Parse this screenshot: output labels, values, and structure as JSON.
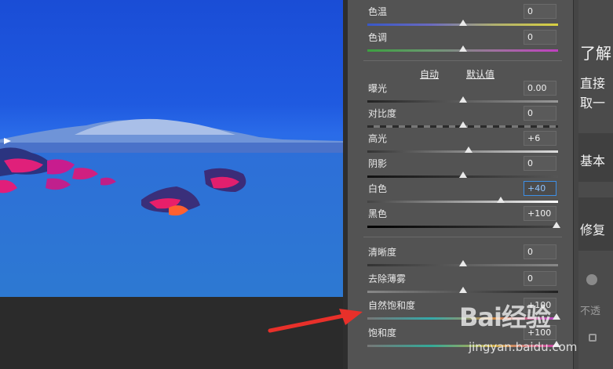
{
  "adjustments": {
    "temperature": {
      "label": "色温",
      "value": "0",
      "position": 0.5
    },
    "tint": {
      "label": "色调",
      "value": "0",
      "position": 0.5
    },
    "auto_label": "自动",
    "default_label": "默认值",
    "exposure": {
      "label": "曝光",
      "value": "0.00",
      "position": 0.5
    },
    "contrast": {
      "label": "对比度",
      "value": "0",
      "position": 0.5
    },
    "highlights": {
      "label": "高光",
      "value": "+6",
      "position": 0.53
    },
    "shadows": {
      "label": "阴影",
      "value": "0",
      "position": 0.5
    },
    "whites": {
      "label": "白色",
      "value": "+40",
      "position": 0.7
    },
    "blacks": {
      "label": "黑色",
      "value": "+100",
      "position": 1.0
    },
    "clarity": {
      "label": "清晰度",
      "value": "0",
      "position": 0.5
    },
    "dehaze": {
      "label": "去除薄雾",
      "value": "0",
      "position": 0.5
    },
    "vibrance": {
      "label": "自然饱和度",
      "value": "+100",
      "position": 1.0
    },
    "saturation": {
      "label": "饱和度",
      "value": "+100",
      "position": 1.0
    }
  },
  "article": {
    "heading_fragment": "了解",
    "line1_fragment": "直接",
    "line2_fragment": "取一",
    "section_basic": "基本",
    "section_repair": "修复",
    "opacity_fragment": "不透"
  },
  "watermark": {
    "brand": "Bai经验",
    "url": "jingyan.baidu.com"
  },
  "colors": {
    "annotation_arrow": "#e8302a",
    "active_field_border": "#3d8fe6"
  }
}
